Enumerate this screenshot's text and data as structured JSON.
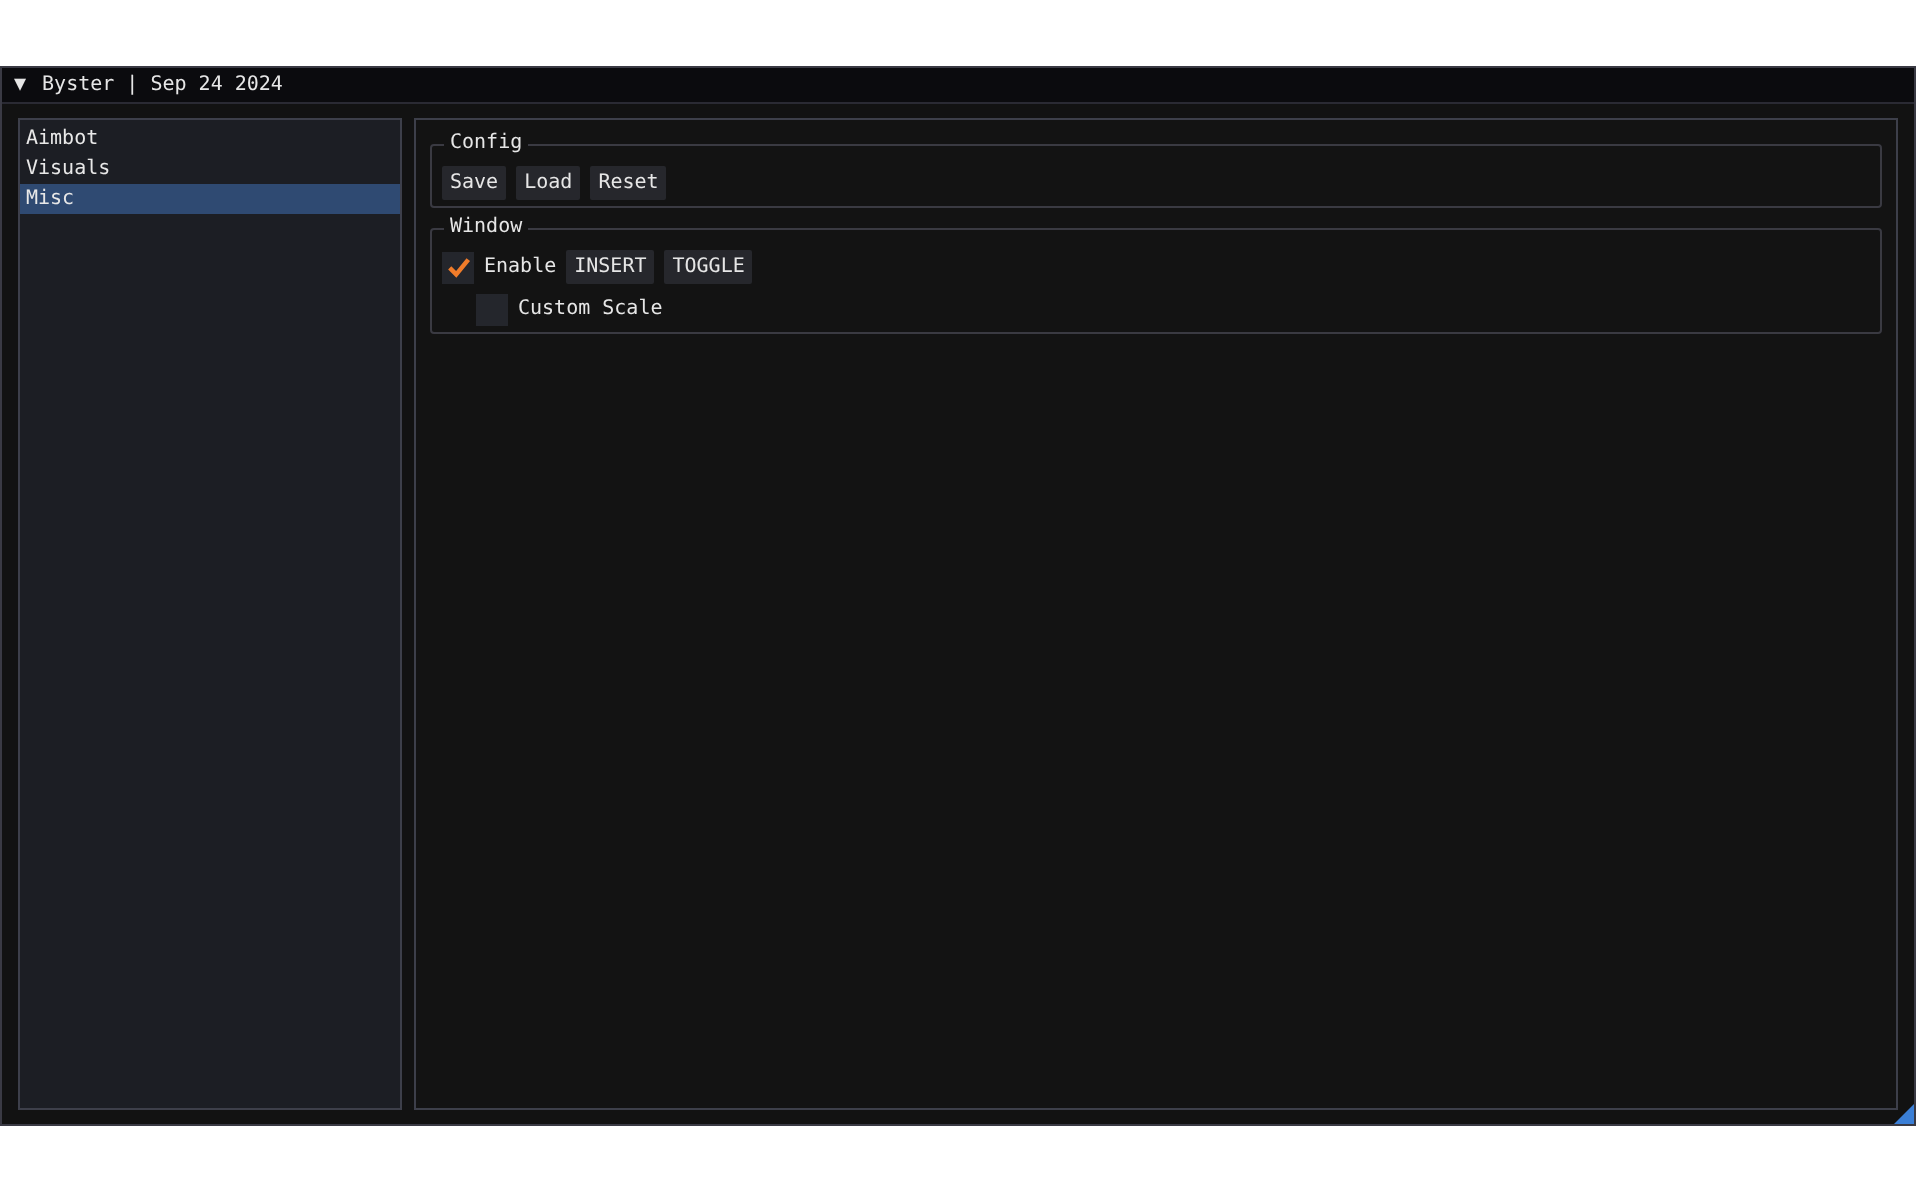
{
  "window": {
    "title_arrow": "▼",
    "title": "Byster | Sep 24 2024"
  },
  "sidebar": {
    "items": [
      {
        "label": "Aimbot",
        "selected": false
      },
      {
        "label": "Visuals",
        "selected": false
      },
      {
        "label": "Misc",
        "selected": true
      }
    ]
  },
  "groups": [
    {
      "title": "Config",
      "rows": [
        {
          "kind": "buttons",
          "buttons": [
            "Save",
            "Load",
            "Reset"
          ]
        }
      ]
    },
    {
      "title": "Window",
      "rows": [
        {
          "kind": "checkbox",
          "label": "Enable",
          "checked": true,
          "buttons": [
            "INSERT",
            "TOGGLE"
          ],
          "children": [
            {
              "kind": "checkbox",
              "label": "Custom Scale",
              "checked": false
            }
          ]
        }
      ]
    }
  ]
}
